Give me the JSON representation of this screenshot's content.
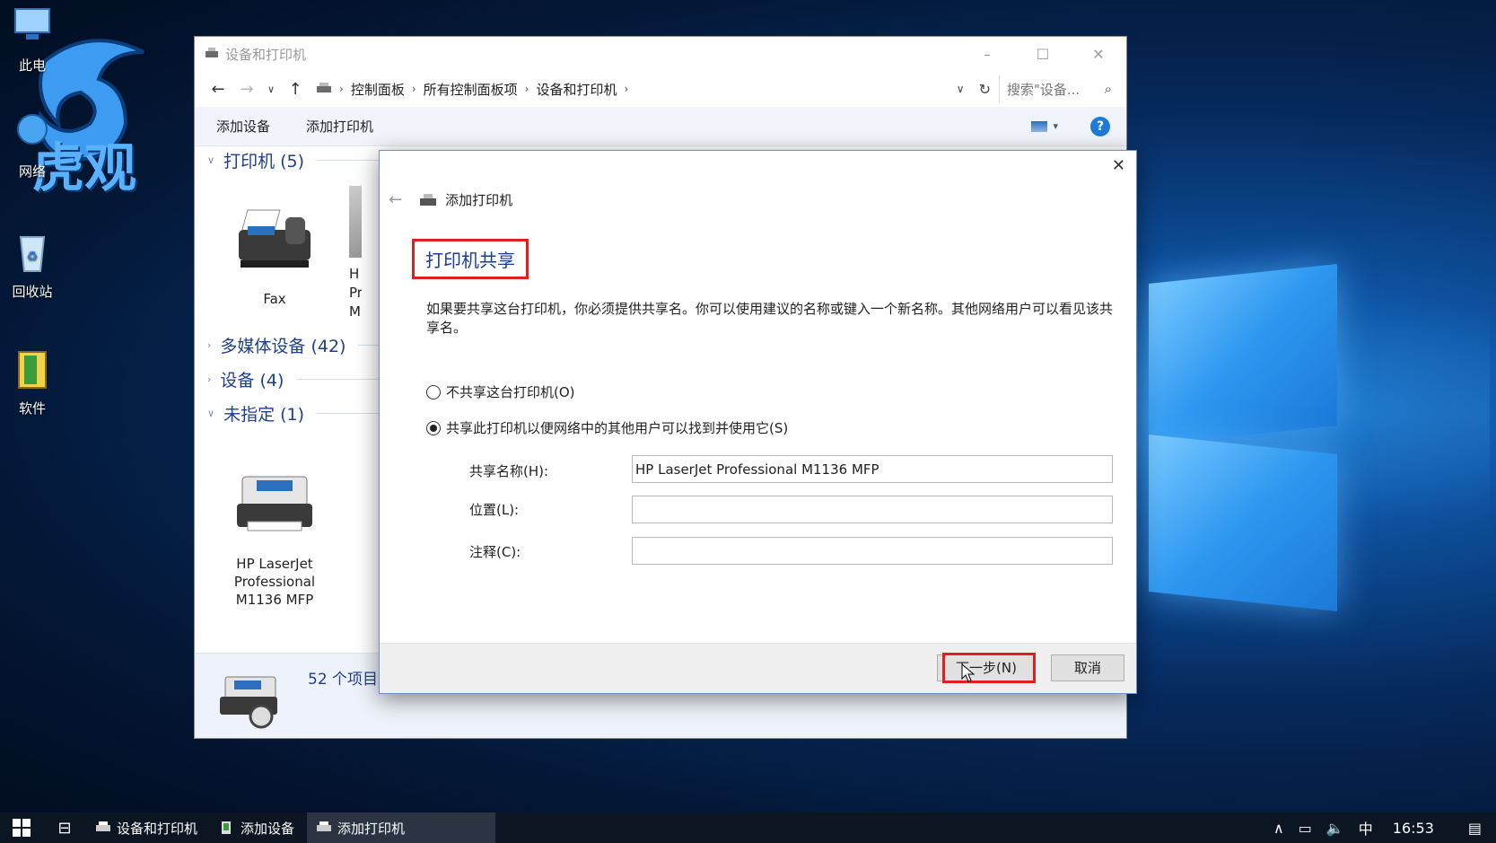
{
  "desktop": {
    "icons": [
      {
        "label": "此电",
        "icon": "computer-icon"
      },
      {
        "label": "网络",
        "icon": "network-icon"
      },
      {
        "label": "回收站",
        "icon": "recycle-bin-icon"
      },
      {
        "label": "软件",
        "icon": "folder-icon"
      }
    ],
    "watermark_text": "虎观"
  },
  "explorer": {
    "title": "设备和打印机",
    "breadcrumbs": [
      "控制面板",
      "所有控制面板项",
      "设备和打印机"
    ],
    "search_placeholder": "搜索\"设备...",
    "commands": [
      "添加设备",
      "添加打印机"
    ],
    "groups": {
      "printers": "打印机 (5)",
      "multimedia": "多媒体设备 (42)",
      "devices": "设备 (4)",
      "unspecified": "未指定 (1)"
    },
    "devices": {
      "fax": "Fax",
      "partial_label": "H\nPr\nM",
      "hp_printer": "HP LaserJet Professional M1136 MFP"
    },
    "status_count": "52 个项目"
  },
  "dialog": {
    "header": "添加打印机",
    "title": "打印机共享",
    "description": "如果要共享这台打印机，你必须提供共享名。你可以使用建议的名称或键入一个新名称。其他网络用户可以看见该共享名。",
    "radio_no_share": "不共享这台打印机(O)",
    "radio_share": "共享此打印机以便网络中的其他用户可以找到并使用它(S)",
    "share_name_label": "共享名称(H):",
    "share_name_value": "HP LaserJet Professional M1136 MFP",
    "location_label": "位置(L):",
    "location_value": "",
    "comment_label": "注释(C):",
    "comment_value": "",
    "next_button": "下一步(N)",
    "cancel_button": "取消"
  },
  "taskbar": {
    "apps": [
      "设备和打印机",
      "添加设备",
      "添加打印机"
    ],
    "ime": "中",
    "clock": "16:53"
  },
  "colors": {
    "accent": "#1a3d99",
    "highlight": "#e02020",
    "taskbar": "#0c1522"
  }
}
